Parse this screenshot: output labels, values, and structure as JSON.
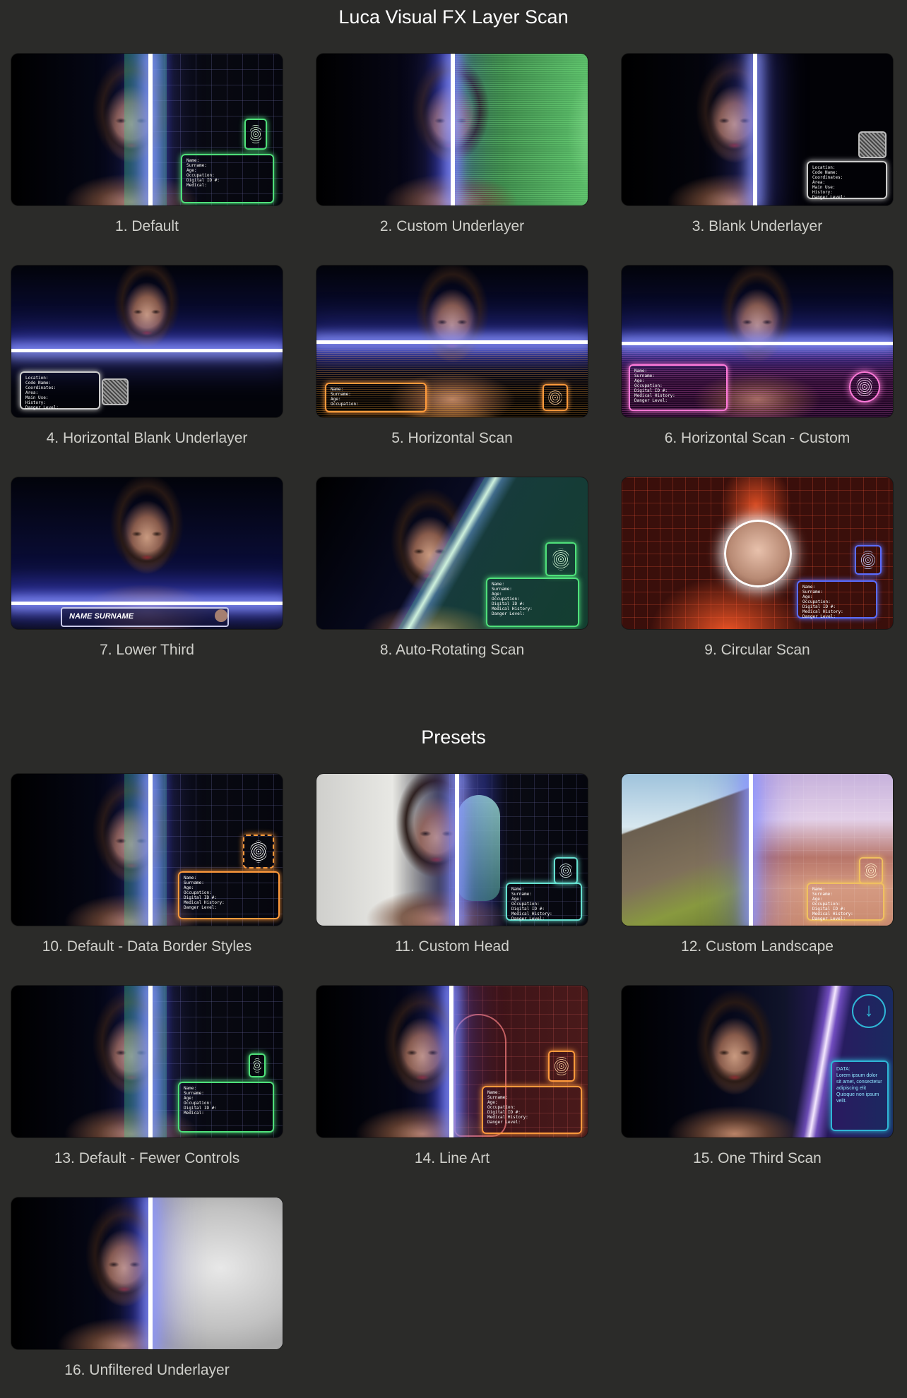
{
  "titles": {
    "main": "Luca Visual FX Layer Scan",
    "presets": "Presets"
  },
  "tiles": [
    {
      "label": "1. Default"
    },
    {
      "label": "2. Custom Underlayer"
    },
    {
      "label": "3. Blank Underlayer"
    },
    {
      "label": "4. Horizontal Blank Underlayer"
    },
    {
      "label": "5. Horizontal Scan"
    },
    {
      "label": "6. Horizontal Scan - Custom"
    },
    {
      "label": "7. Lower Third"
    },
    {
      "label": "8. Auto-Rotating Scan"
    },
    {
      "label": "9. Circular Scan"
    },
    {
      "label": "10. Default - Data Border Styles"
    },
    {
      "label": "11. Custom Head"
    },
    {
      "label": "12. Custom Landscape"
    },
    {
      "label": "13. Default - Fewer Controls"
    },
    {
      "label": "14. Line Art"
    },
    {
      "label": "15. One Third Scan"
    },
    {
      "label": "16. Unfiltered Underlayer"
    }
  ],
  "hud": {
    "fields_long": "Name:\nSurname:\nAge:\nOccupation:\nDigital ID #:\nMedical History:\nDanger Level:",
    "fields_short": "Name:\nSurname:\nAge:\nOccupation:\nDigital ID #:\nMedical:",
    "fields_location": "Location:\nCode Name:\nCoordinates:\nArea:\nMain Use:\nHistory:\nDanger Level:",
    "fields_min": "Name:\nSurname:\nAge:\nOccupation:",
    "lower_third_name": "NAME SURNAME",
    "lorem": "DATA:\nLorem ipsum dolor\nsit amet, consectetur\nadipiscing elit\nQuisque non ipsum\nvelit."
  },
  "colors": {
    "background": "#2b2b29",
    "title": "#ffffff",
    "label": "#cfcfca",
    "green": "#4fe07a",
    "orange": "#ff9a3c",
    "pink": "#ff7ad9",
    "blue": "#5b6dff",
    "teal": "#66e0d0",
    "cyan": "#2fb6d6",
    "red": "#ff5533"
  }
}
